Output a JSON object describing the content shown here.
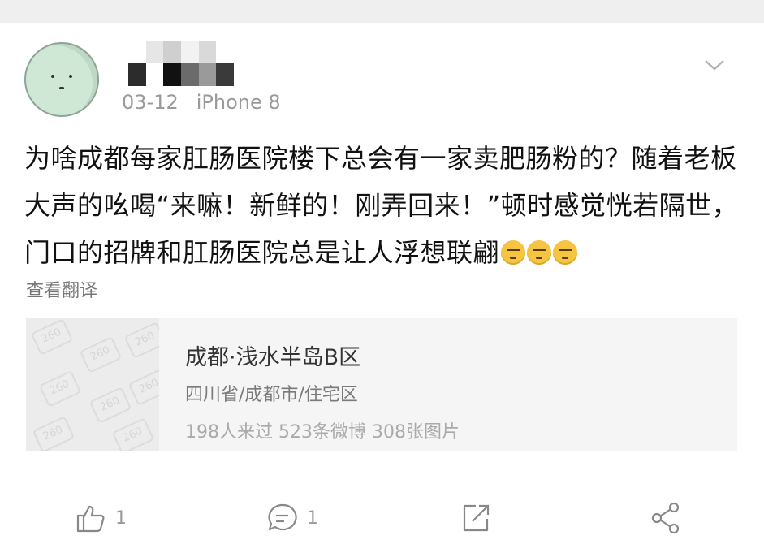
{
  "post": {
    "date": "03-12",
    "device": "iPhone 8",
    "text": "为啥成都每家肛肠医院楼下总会有一家卖肥肠粉的？随着老板大声的吆喝“来嘛！新鲜的！刚弄回来！”顿时感觉恍若隔世，门口的招牌和肛肠医院总是让人浮想联翩",
    "translate_label": "查看翻译"
  },
  "location": {
    "title": "成都·浅水半岛B区",
    "subtitle": "四川省/成都市/住宅区",
    "stats": "198人来过 523条微博 308张图片"
  },
  "actions": {
    "like_count": "1",
    "comment_count": "1"
  },
  "icons": {
    "menu": "chevron-down-icon",
    "like": "thumbs-up-icon",
    "comment": "comment-icon",
    "repost": "share-out-icon",
    "share": "share-icon"
  },
  "colors": {
    "text": "#111111",
    "meta": "#9a9a9a",
    "location_bg": "#f5f5f5"
  }
}
